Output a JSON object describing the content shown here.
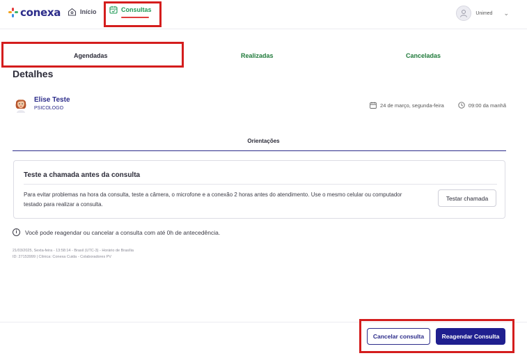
{
  "nav": {
    "brand": "conexa",
    "home_label": "Início",
    "consultas_label": "Consultas",
    "user_name": "Unimed"
  },
  "tabs": [
    {
      "label": "Agendadas",
      "active": true
    },
    {
      "label": "Realizadas",
      "active": false
    },
    {
      "label": "Canceladas",
      "active": false
    }
  ],
  "details": {
    "title": "Detalhes",
    "professional_name": "Elise Teste",
    "professional_role": "PSICOLOGO",
    "date": "24 de março, segunda-feira",
    "time": "09:00 da manhã"
  },
  "orientations": {
    "title": "Orientações",
    "card_title": "Teste a chamada antes da consulta",
    "card_text": "Para evitar problemas na hora da consulta, teste a câmera, o microfone e a conexão 2 horas antes do atendimento. Use o mesmo celular ou computador testado para realizar a consulta.",
    "test_button": "Testar chamada"
  },
  "info_text": "Você pode reagendar ou cancelar a consulta com até 0h de antecedência.",
  "meta": {
    "line1": "21/03/2025, Sexta-feira - 13:58:14 - Brasil (UTC-3) - Horário de Brasília",
    "line2": "ID: 27153999 | Clínica: Conexa Cuida - Colaboradores PV"
  },
  "actions": {
    "cancel": "Cancelar consulta",
    "reschedule": "Reagendar Consulta"
  },
  "colors": {
    "brand_navy": "#2c2c8a",
    "primary_button": "#1f1f8f",
    "active_green": "#1f9a56",
    "highlight_red": "#d41d1d"
  }
}
